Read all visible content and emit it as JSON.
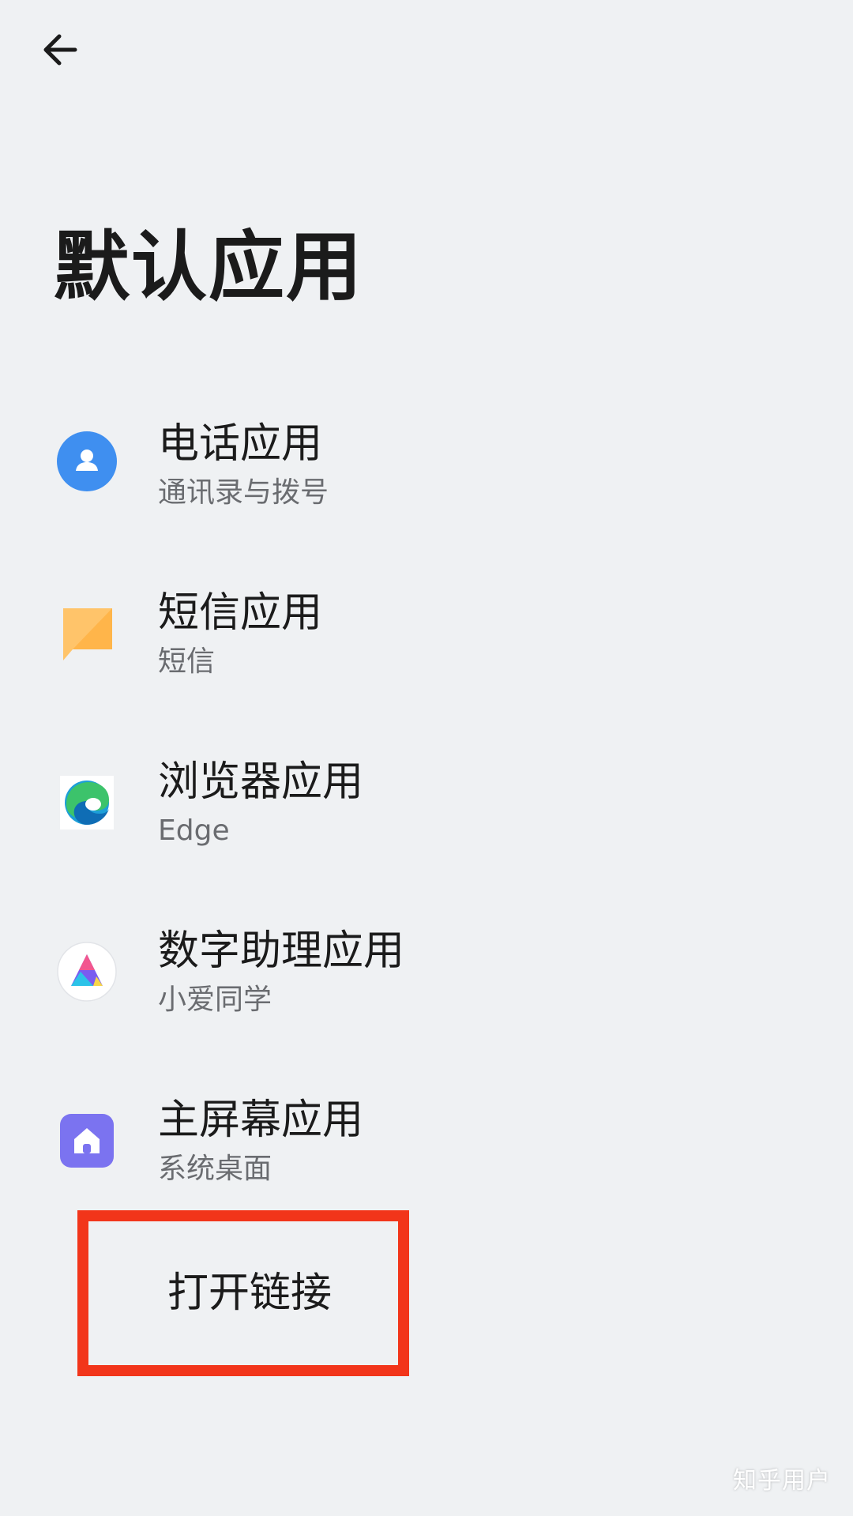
{
  "header": {
    "back_icon": "arrow-left-icon",
    "title": "默认应用"
  },
  "items": [
    {
      "title": "电话应用",
      "subtitle": "通讯录与拨号",
      "icon": "contacts-icon",
      "icon_color": "#3f8ff0"
    },
    {
      "title": "短信应用",
      "subtitle": "短信",
      "icon": "message-icon",
      "icon_color": "#ffc46a"
    },
    {
      "title": "浏览器应用",
      "subtitle": "Edge",
      "icon": "edge-browser-icon",
      "icon_color": "#1d9fd8"
    },
    {
      "title": "数字助理应用",
      "subtitle": "小爱同学",
      "icon": "xiaoai-assistant-icon",
      "icon_color": "#ffffff"
    },
    {
      "title": "主屏幕应用",
      "subtitle": "系统桌面",
      "icon": "home-launcher-icon",
      "icon_color": "#7b73f0"
    }
  ],
  "open_links": {
    "label": "打开链接",
    "highlight_color": "#f2351a"
  },
  "watermark": "知乎用户"
}
